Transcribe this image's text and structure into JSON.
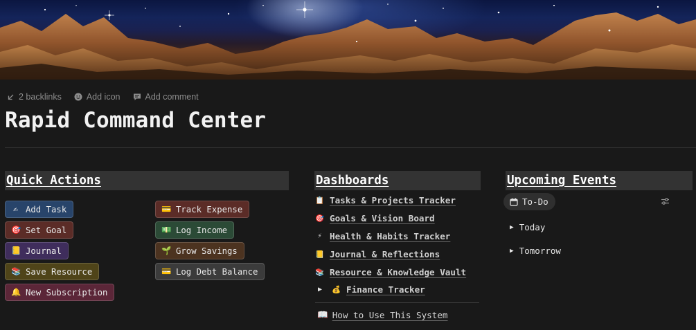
{
  "page": {
    "title": "Rapid Command Center",
    "meta": {
      "backlinks": "2 backlinks",
      "add_icon": "Add icon",
      "add_comment": "Add comment"
    }
  },
  "quick_actions": {
    "header": "Quick Actions",
    "left_buttons": [
      {
        "emoji": "✍",
        "label": "Add Task",
        "color": "#28446a"
      },
      {
        "emoji": "🎯",
        "label": "Set Goal",
        "color": "#5b2c27"
      },
      {
        "emoji": "📒",
        "label": "Journal",
        "color": "#3f2d5c"
      },
      {
        "emoji": "📚",
        "label": "Save Resource",
        "color": "#4f4419"
      },
      {
        "emoji": "🔔",
        "label": "New Subscription",
        "color": "#5b2638"
      }
    ],
    "right_buttons": [
      {
        "emoji": "💳",
        "label": "Track Expense",
        "color": "#5b2c27"
      },
      {
        "emoji": "💵",
        "label": "Log Income",
        "color": "#2b4a36"
      },
      {
        "emoji": "🌱",
        "label": "Grow Savings",
        "color": "#4c3320"
      },
      {
        "emoji": "💳",
        "label": "Log Debt Balance",
        "color": "#3b3b3b"
      }
    ]
  },
  "dashboards": {
    "header": "Dashboards",
    "items": [
      {
        "emoji": "📋",
        "label": "Tasks & Projects Tracker"
      },
      {
        "emoji": "🎯",
        "label": "Goals & Vision Board"
      },
      {
        "emoji": "⚡",
        "label": "Health & Habits Tracker"
      },
      {
        "emoji": "📒",
        "label": "Journal & Reflections"
      },
      {
        "emoji": "📚",
        "label": "Resource & Knowledge Vault"
      }
    ],
    "finance": {
      "emoji": "💰",
      "label": "Finance Tracker"
    },
    "how_to": {
      "emoji": "📖",
      "label": "How to Use This System"
    }
  },
  "upcoming": {
    "header": "Upcoming Events",
    "view_tab": "To-Do",
    "groups": [
      "Today",
      "Tomorrow"
    ]
  }
}
